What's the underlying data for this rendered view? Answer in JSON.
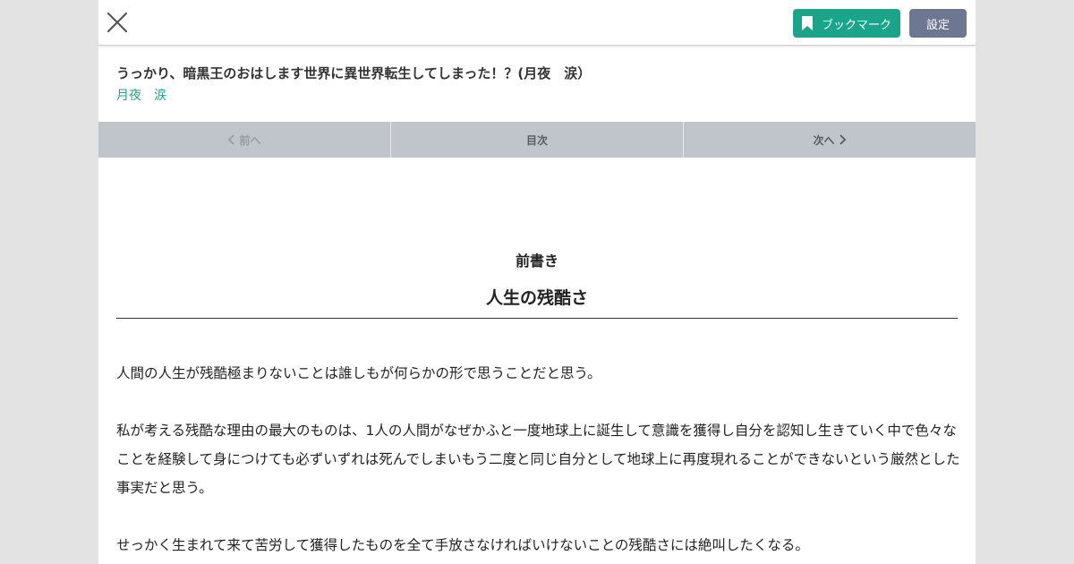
{
  "header": {
    "close_icon": "close-x-icon",
    "bookmark_icon": "bookmark-icon",
    "bookmark_label": "ブックマーク",
    "settings_label": "設定",
    "bookmark_color": "#1aa58a",
    "settings_color": "#6e7791"
  },
  "novel": {
    "title": "うっかり、暗黒王のおはします世界に異世界転生してしまった！？(月夜　涙）",
    "author": "月夜　涙",
    "link_color": "#1aa58a"
  },
  "nav": {
    "prev_label": "前へ",
    "toc_label": "目次",
    "next_label": "次へ"
  },
  "content": {
    "preface_label": "前書き",
    "chapter_title": "人生の残酷さ",
    "paragraphs": [
      "人間の人生が残酷極まりないことは誰しもが何らかの形で思うことだと思う。",
      "私が考える残酷な理由の最大のものは、1人の人間がなぜかふと一度地球上に誕生して意識を獲得し自分を認知し生きていく中で色々なことを経験して身につけても必ずいずれは死んでしまいもう二度と同じ自分として地球上に再度現れることができないという厳然とした事実だと思う。",
      "せっかく生まれて来て苦労して獲得したものを全て手放さなければいけないことの残酷さには絶叫したくなる。"
    ]
  }
}
